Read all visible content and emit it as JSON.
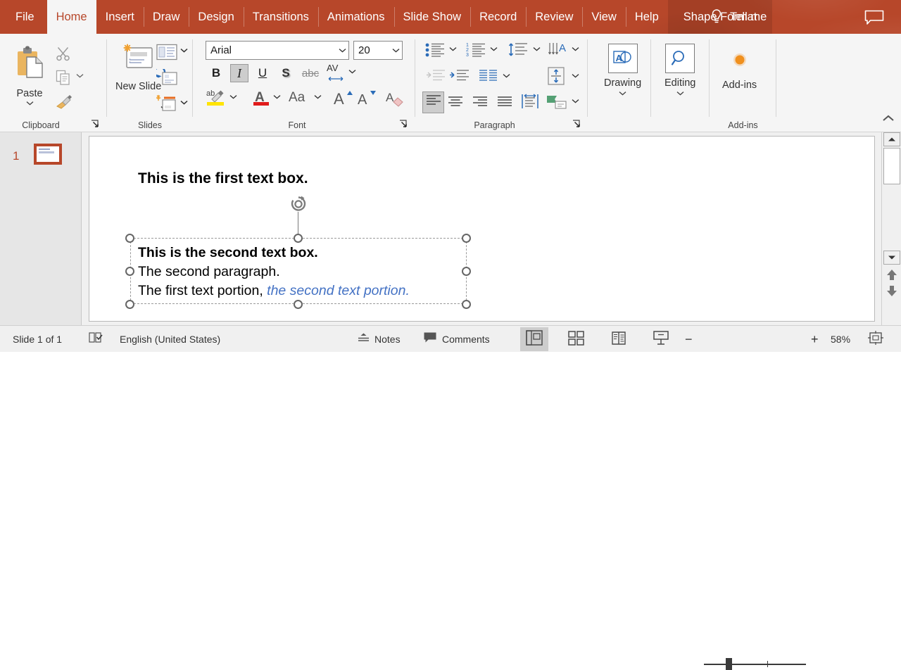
{
  "tabs": [
    {
      "label": "File",
      "state": "normal"
    },
    {
      "label": "Home",
      "state": "active"
    },
    {
      "label": "Insert",
      "state": "normal"
    },
    {
      "label": "Draw",
      "state": "normal"
    },
    {
      "label": "Design",
      "state": "normal"
    },
    {
      "label": "Transitions",
      "state": "normal"
    },
    {
      "label": "Animations",
      "state": "normal"
    },
    {
      "label": "Slide Show",
      "state": "normal"
    },
    {
      "label": "Record",
      "state": "normal"
    },
    {
      "label": "Review",
      "state": "normal"
    },
    {
      "label": "View",
      "state": "normal"
    },
    {
      "label": "Help",
      "state": "normal"
    },
    {
      "label": "Shape Format",
      "state": "contextual"
    }
  ],
  "titlebar": {
    "tell_me": "Tell me",
    "bulb_icon": "lightbulb-icon",
    "comment_icon": "comment-icon",
    "accent_color": "#b7472a"
  },
  "ribbon": {
    "groups": [
      {
        "name": "Clipboard",
        "label": "Clipboard",
        "has_launcher": true
      },
      {
        "name": "Slides",
        "label": "Slides",
        "has_launcher": false
      },
      {
        "name": "Font",
        "label": "Font",
        "has_launcher": true
      },
      {
        "name": "Paragraph",
        "label": "Paragraph",
        "has_launcher": true
      },
      {
        "name": "Add-ins",
        "label": "Add-ins",
        "has_launcher": false
      }
    ],
    "clipboard": {
      "paste_label": "Paste",
      "paste_icon": "clipboard-icon",
      "cut_icon": "scissors-icon",
      "copy_icon": "copy-icon",
      "format_painter_icon": "format-painter-icon"
    },
    "slides": {
      "new_slide_label": "New Slide",
      "new_slide_icon": "new-slide-icon",
      "layout_icon": "slide-layout-icon",
      "reset_icon": "slide-reset-icon",
      "section_icon": "slide-section-icon"
    },
    "font": {
      "font_name": "Arial",
      "font_size": "20",
      "bold_label": "B",
      "italic_label": "I",
      "italic_active": true,
      "underline_label": "U",
      "shadow_label": "S",
      "strikethrough_label": "abc",
      "char_spacing_label": "AV",
      "text_highlight_icon": "text-highlight-icon",
      "font_color_icon": "font-color-icon",
      "change_case_label": "Aa",
      "increase_size_label": "A",
      "decrease_size_label": "A",
      "clear_formatting_icon": "clear-formatting-icon"
    },
    "paragraph": {
      "bullets_icon": "bullets-icon",
      "numbering_icon": "numbering-icon",
      "line_spacing_icon": "line-spacing-icon",
      "text_direction_icon": "text-direction-icon",
      "decrease_indent_icon": "decrease-indent-icon",
      "increase_indent_icon": "increase-indent-icon",
      "columns_icon": "columns-icon",
      "align_text_icon": "align-text-vertical-icon",
      "align_left_icon": "align-left-icon",
      "align_left_active": true,
      "align_center_icon": "align-center-icon",
      "align_right_icon": "align-right-icon",
      "justify_icon": "justify-icon",
      "fit_text_icon": "fit-text-icon",
      "smartart_icon": "convert-to-smartart-icon"
    },
    "drawing": {
      "label": "Drawing",
      "icon": "drawing-shapes-icon"
    },
    "editing": {
      "label": "Editing",
      "icon": "magnifier-icon"
    },
    "addins": {
      "label": "Add-ins",
      "icon": "addins-dot-icon"
    },
    "collapse_icon": "collapse-ribbon-icon"
  },
  "thumbnails": {
    "slides": [
      {
        "number": "1",
        "selected": true
      }
    ]
  },
  "slide": {
    "textbox1": {
      "text": "This is the first text box."
    },
    "textbox2": {
      "selected": true,
      "lines": [
        {
          "text": "This is the second text box.",
          "bold": true
        },
        {
          "text": "The second paragraph.",
          "bold": false
        },
        {
          "text": "The first text portion, ",
          "bold": false,
          "tail": "the second text portion.",
          "tail_color": "#4472c4"
        }
      ]
    },
    "rotation_handle_icon": "rotation-handle-icon"
  },
  "scrollbar": {
    "up_icon": "scroll-up-icon",
    "down_icon": "scroll-down-icon",
    "previous_slide_icon": "previous-slide-icon",
    "next_slide_icon": "next-slide-icon"
  },
  "status": {
    "slide_count": "Slide 1 of 1",
    "spellcheck_icon": "spellcheck-icon",
    "language": "English (United States)",
    "notes_label": "Notes",
    "notes_icon": "notes-icon",
    "comments_label": "Comments",
    "comments_icon": "comments-icon",
    "views": [
      {
        "name": "normal-view",
        "icon": "normal-view-icon",
        "active": true
      },
      {
        "name": "slide-sorter-view",
        "icon": "slide-sorter-icon",
        "active": false
      },
      {
        "name": "reading-view",
        "icon": "reading-view-icon",
        "active": false
      },
      {
        "name": "slide-show-view",
        "icon": "slide-show-icon",
        "active": false
      }
    ],
    "zoom_out_label": "−",
    "zoom_in_label": "+",
    "zoom_level": "58%",
    "fit_slide_icon": "fit-slide-to-window-icon"
  }
}
